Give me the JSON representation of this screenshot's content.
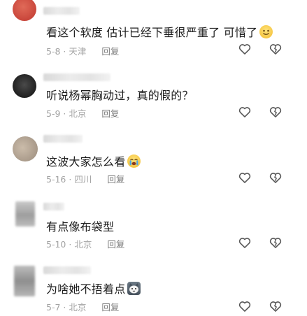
{
  "comments": [
    {
      "text": "看这个软度  估计已经下垂很严重了   可惜了",
      "emoji": "smile-emoji",
      "date": "5-8",
      "location": "天津",
      "reply_label": "回复",
      "avatar_color": "#d9574a"
    },
    {
      "text": "听说杨幂胸动过，真的假的？",
      "emoji": "",
      "date": "5-9",
      "location": "北京",
      "reply_label": "回复",
      "avatar_color": "#2a2a2a"
    },
    {
      "text": "这波大家怎么看",
      "emoji": "crying-emoji",
      "date": "5-16",
      "location": "四川",
      "reply_label": "回复",
      "avatar_color": "#b9a99a"
    },
    {
      "text": "有点像布袋型",
      "emoji": "",
      "date": "5-10",
      "location": "北京",
      "reply_label": "回复",
      "avatar_color": "#a6a6a6"
    },
    {
      "text": "为啥她不捂着点",
      "emoji": "cat-emoji",
      "date": "5-7",
      "location": "北京",
      "reply_label": "回复",
      "avatar_color": "#9c9c9c"
    }
  ],
  "meta_separator": "·",
  "icons": {
    "like": "heart-icon",
    "dislike": "broken-heart-icon"
  }
}
